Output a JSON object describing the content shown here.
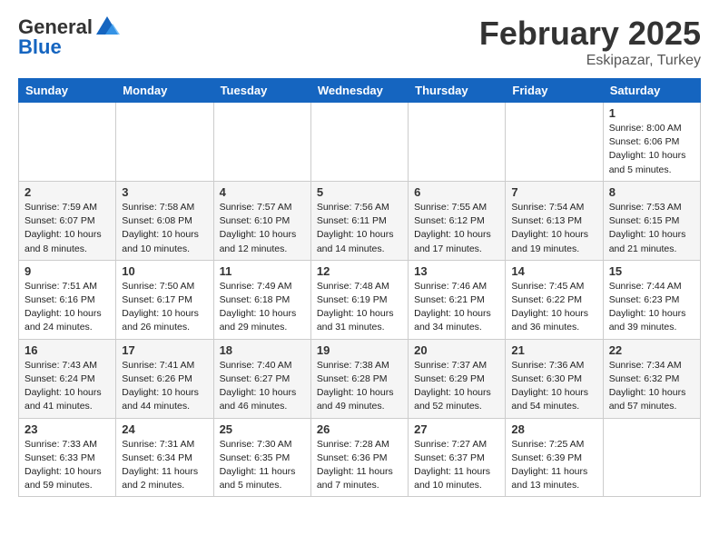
{
  "header": {
    "logo_general": "General",
    "logo_blue": "Blue",
    "month_title": "February 2025",
    "location": "Eskipazar, Turkey"
  },
  "weekdays": [
    "Sunday",
    "Monday",
    "Tuesday",
    "Wednesday",
    "Thursday",
    "Friday",
    "Saturday"
  ],
  "weeks": [
    [
      {
        "day": "",
        "info": ""
      },
      {
        "day": "",
        "info": ""
      },
      {
        "day": "",
        "info": ""
      },
      {
        "day": "",
        "info": ""
      },
      {
        "day": "",
        "info": ""
      },
      {
        "day": "",
        "info": ""
      },
      {
        "day": "1",
        "info": "Sunrise: 8:00 AM\nSunset: 6:06 PM\nDaylight: 10 hours\nand 5 minutes."
      }
    ],
    [
      {
        "day": "2",
        "info": "Sunrise: 7:59 AM\nSunset: 6:07 PM\nDaylight: 10 hours\nand 8 minutes."
      },
      {
        "day": "3",
        "info": "Sunrise: 7:58 AM\nSunset: 6:08 PM\nDaylight: 10 hours\nand 10 minutes."
      },
      {
        "day": "4",
        "info": "Sunrise: 7:57 AM\nSunset: 6:10 PM\nDaylight: 10 hours\nand 12 minutes."
      },
      {
        "day": "5",
        "info": "Sunrise: 7:56 AM\nSunset: 6:11 PM\nDaylight: 10 hours\nand 14 minutes."
      },
      {
        "day": "6",
        "info": "Sunrise: 7:55 AM\nSunset: 6:12 PM\nDaylight: 10 hours\nand 17 minutes."
      },
      {
        "day": "7",
        "info": "Sunrise: 7:54 AM\nSunset: 6:13 PM\nDaylight: 10 hours\nand 19 minutes."
      },
      {
        "day": "8",
        "info": "Sunrise: 7:53 AM\nSunset: 6:15 PM\nDaylight: 10 hours\nand 21 minutes."
      }
    ],
    [
      {
        "day": "9",
        "info": "Sunrise: 7:51 AM\nSunset: 6:16 PM\nDaylight: 10 hours\nand 24 minutes."
      },
      {
        "day": "10",
        "info": "Sunrise: 7:50 AM\nSunset: 6:17 PM\nDaylight: 10 hours\nand 26 minutes."
      },
      {
        "day": "11",
        "info": "Sunrise: 7:49 AM\nSunset: 6:18 PM\nDaylight: 10 hours\nand 29 minutes."
      },
      {
        "day": "12",
        "info": "Sunrise: 7:48 AM\nSunset: 6:19 PM\nDaylight: 10 hours\nand 31 minutes."
      },
      {
        "day": "13",
        "info": "Sunrise: 7:46 AM\nSunset: 6:21 PM\nDaylight: 10 hours\nand 34 minutes."
      },
      {
        "day": "14",
        "info": "Sunrise: 7:45 AM\nSunset: 6:22 PM\nDaylight: 10 hours\nand 36 minutes."
      },
      {
        "day": "15",
        "info": "Sunrise: 7:44 AM\nSunset: 6:23 PM\nDaylight: 10 hours\nand 39 minutes."
      }
    ],
    [
      {
        "day": "16",
        "info": "Sunrise: 7:43 AM\nSunset: 6:24 PM\nDaylight: 10 hours\nand 41 minutes."
      },
      {
        "day": "17",
        "info": "Sunrise: 7:41 AM\nSunset: 6:26 PM\nDaylight: 10 hours\nand 44 minutes."
      },
      {
        "day": "18",
        "info": "Sunrise: 7:40 AM\nSunset: 6:27 PM\nDaylight: 10 hours\nand 46 minutes."
      },
      {
        "day": "19",
        "info": "Sunrise: 7:38 AM\nSunset: 6:28 PM\nDaylight: 10 hours\nand 49 minutes."
      },
      {
        "day": "20",
        "info": "Sunrise: 7:37 AM\nSunset: 6:29 PM\nDaylight: 10 hours\nand 52 minutes."
      },
      {
        "day": "21",
        "info": "Sunrise: 7:36 AM\nSunset: 6:30 PM\nDaylight: 10 hours\nand 54 minutes."
      },
      {
        "day": "22",
        "info": "Sunrise: 7:34 AM\nSunset: 6:32 PM\nDaylight: 10 hours\nand 57 minutes."
      }
    ],
    [
      {
        "day": "23",
        "info": "Sunrise: 7:33 AM\nSunset: 6:33 PM\nDaylight: 10 hours\nand 59 minutes."
      },
      {
        "day": "24",
        "info": "Sunrise: 7:31 AM\nSunset: 6:34 PM\nDaylight: 11 hours\nand 2 minutes."
      },
      {
        "day": "25",
        "info": "Sunrise: 7:30 AM\nSunset: 6:35 PM\nDaylight: 11 hours\nand 5 minutes."
      },
      {
        "day": "26",
        "info": "Sunrise: 7:28 AM\nSunset: 6:36 PM\nDaylight: 11 hours\nand 7 minutes."
      },
      {
        "day": "27",
        "info": "Sunrise: 7:27 AM\nSunset: 6:37 PM\nDaylight: 11 hours\nand 10 minutes."
      },
      {
        "day": "28",
        "info": "Sunrise: 7:25 AM\nSunset: 6:39 PM\nDaylight: 11 hours\nand 13 minutes."
      },
      {
        "day": "",
        "info": ""
      }
    ]
  ]
}
